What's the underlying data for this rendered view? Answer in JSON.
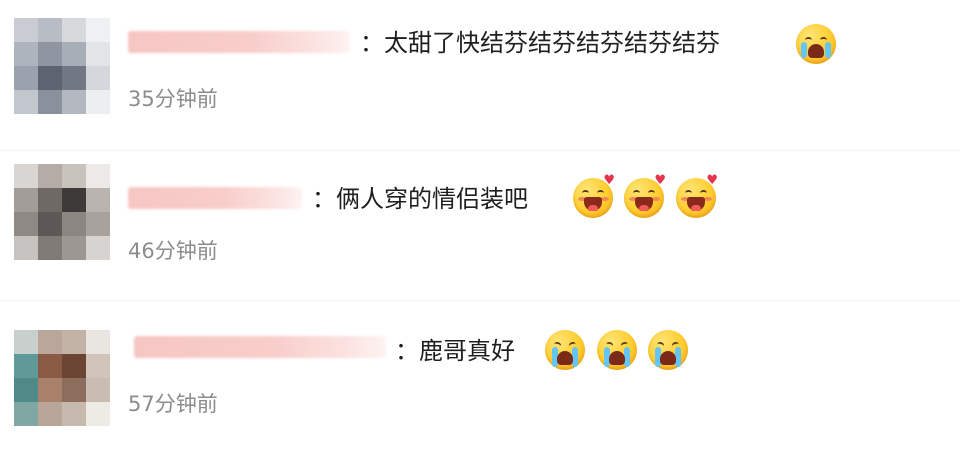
{
  "comments": [
    {
      "text": "：太甜了快结芬结芬结芬结芬结芬",
      "time": "35分钟前",
      "emojis": [
        "loudly-crying-face-icon"
      ]
    },
    {
      "text": "：俩人穿的情侣装吧",
      "time": "46分钟前",
      "emojis": [
        "blushing-heart-face-icon",
        "blushing-heart-face-icon",
        "blushing-heart-face-icon"
      ]
    },
    {
      "text": "：鹿哥真好",
      "time": "57分钟前",
      "emojis": [
        "crying-face-icon",
        "crying-face-icon",
        "crying-face-icon"
      ]
    }
  ],
  "colors": {
    "text": "#1f1f1f",
    "time": "#8c8c8c",
    "name_blur": "#f6c6c3",
    "emoji_yellow": "#ffcd2e"
  }
}
